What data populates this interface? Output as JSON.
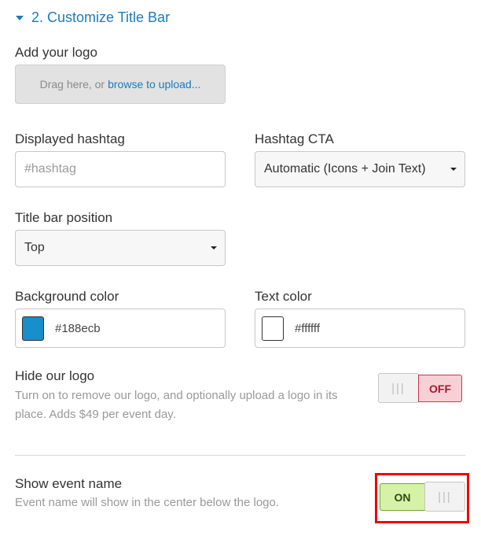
{
  "section": {
    "title": "2. Customize Title Bar",
    "expanded": true
  },
  "logo": {
    "label": "Add your logo",
    "upload_text": "Drag here, or",
    "upload_link": "browse to upload..."
  },
  "hashtag": {
    "label": "Displayed hashtag",
    "value": "",
    "placeholder": "#hashtag"
  },
  "hashtag_cta": {
    "label": "Hashtag CTA",
    "selected": "Automatic (Icons + Join Text)"
  },
  "title_bar_position": {
    "label": "Title bar position",
    "selected": "Top"
  },
  "background_color": {
    "label": "Background color",
    "value": "#188ecb",
    "swatch": "#188ecb"
  },
  "text_color": {
    "label": "Text color",
    "value": "#ffffff",
    "swatch": "#ffffff"
  },
  "hide_logo": {
    "title": "Hide our logo",
    "description": "Turn on to remove our logo, and optionally upload a logo in its place. Adds $49 per event day.",
    "state_label": "OFF",
    "handle": "|||",
    "on": false
  },
  "show_event_name": {
    "title": "Show event name",
    "description": "Event name will show in the center below the logo.",
    "state_label": "ON",
    "handle": "|||",
    "on": true
  },
  "colors": {
    "accent": "#1a7bbd",
    "off": "#f7d0d6",
    "on": "#d6f2a6",
    "highlight": "#ee0000"
  }
}
